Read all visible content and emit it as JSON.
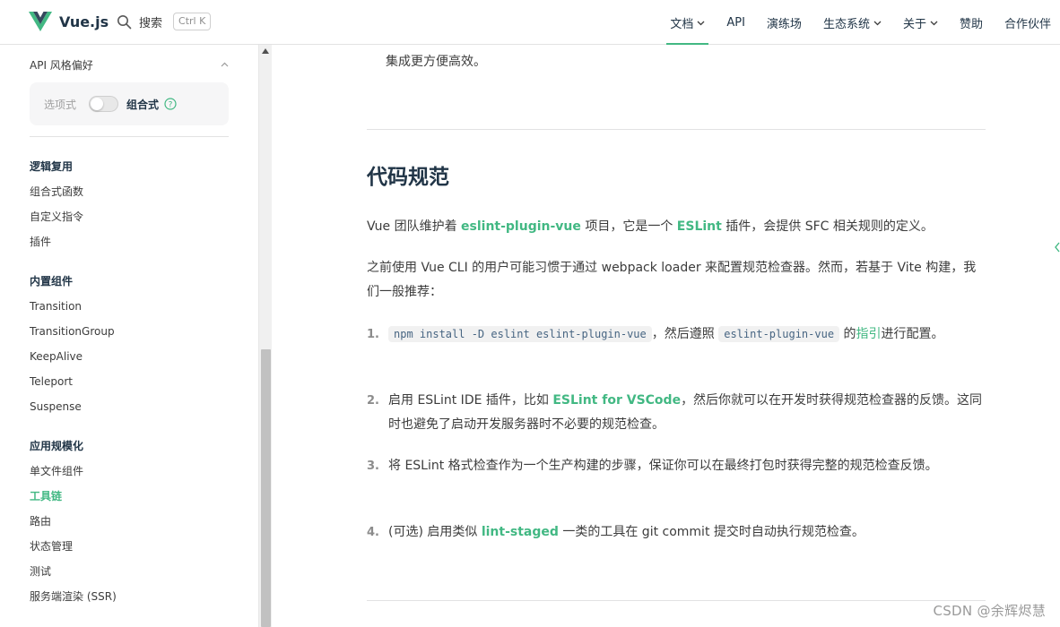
{
  "brand": {
    "name": "Vue.js"
  },
  "search": {
    "label": "搜索",
    "shortcut": "Ctrl K"
  },
  "nav": {
    "items": [
      {
        "label": "文档",
        "dropdown": true,
        "active": true
      },
      {
        "label": "API",
        "dropdown": false
      },
      {
        "label": "演练场",
        "dropdown": false
      },
      {
        "label": "生态系统",
        "dropdown": true
      },
      {
        "label": "关于",
        "dropdown": true
      },
      {
        "label": "赞助",
        "dropdown": false
      },
      {
        "label": "合作伙伴",
        "dropdown": false
      }
    ]
  },
  "sidebar": {
    "api_pref_title": "API 风格偏好",
    "options_api": "选项式",
    "composition_api": "组合式",
    "groups": [
      {
        "title": "逻辑复用",
        "links": [
          "组合式函数",
          "自定义指令",
          "插件"
        ]
      },
      {
        "title": "内置组件",
        "links": [
          "Transition",
          "TransitionGroup",
          "KeepAlive",
          "Teleport",
          "Suspense"
        ]
      },
      {
        "title": "应用规模化",
        "links": [
          "单文件组件",
          "工具链",
          "路由",
          "状态管理",
          "测试",
          "服务端渲染 (SSR)"
        ],
        "active": "工具链"
      }
    ]
  },
  "content": {
    "prev_tail": "集成更方便高效。",
    "heading": "代码规范",
    "p1": {
      "t1": "Vue 团队维护着 ",
      "link1": "eslint-plugin-vue",
      "t2": " 项目，它是一个 ",
      "link2": "ESLint",
      "t3": " 插件，会提供 SFC 相关规则的定义。"
    },
    "p2": "之前使用 Vue CLI 的用户可能习惯于通过 webpack loader 来配置规范检查器。然而，若基于 Vite 构建，我们一般推荐：",
    "list": [
      {
        "num": "1.",
        "code1": "npm install -D eslint eslint-plugin-vue",
        "t1": "，然后遵照 ",
        "code2": "eslint-plugin-vue",
        "t2": " 的",
        "link": "指引",
        "t3": "进行配置。"
      },
      {
        "num": "2.",
        "t1": "启用 ESLint IDE 插件，比如 ",
        "link": "ESLint for VSCode",
        "t2": "，然后你就可以在开发时获得规范检查器的反馈。这同时也避免了启动开发服务器时不必要的规范检查。"
      },
      {
        "num": "3.",
        "t1": "将 ESLint 格式检查作为一个生产构建的步骤，保证你可以在最终打包时获得完整的规范检查反馈。"
      },
      {
        "num": "4.",
        "t1": "(可选) 启用类似 ",
        "link": "lint-staged",
        "t2": " 一类的工具在 git commit 提交时自动执行规范检查。"
      }
    ]
  },
  "watermark": "CSDN @余辉烬慧",
  "colors": {
    "accent": "#42b883",
    "text": "#213547",
    "muted": "#3c3c3c",
    "code_bg": "#f1f1f1"
  }
}
